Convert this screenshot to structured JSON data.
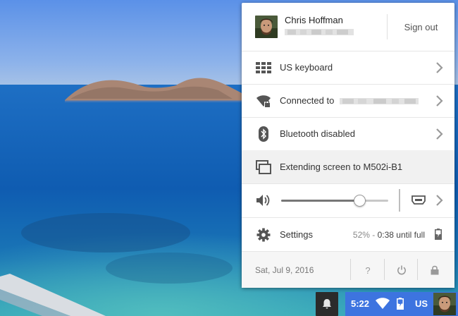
{
  "user": {
    "name": "Chris Hoffman",
    "signout_label": "Sign out"
  },
  "menu": {
    "keyboard_label": "US keyboard",
    "wifi_prefix": "Connected to",
    "bluetooth_label": "Bluetooth disabled",
    "display_label": "Extending screen to M502i-B1",
    "volume_level": 0.73,
    "settings_label": "Settings",
    "battery_percent": "52%",
    "battery_sep": " - ",
    "battery_remaining": "0:38 until full"
  },
  "footer": {
    "date": "Sat, Jul 9, 2016",
    "help_label": "?"
  },
  "shelf": {
    "time": "5:22",
    "ime_indicator": "US"
  },
  "icons": {
    "keyboard": "keyboard-icon",
    "wifi": "wifi-lock-icon",
    "bluetooth": "bluetooth-icon",
    "display": "display-extend-icon",
    "volume": "speaker-icon",
    "hdmi": "hdmi-output-icon",
    "settings": "gear-icon",
    "power": "power-icon",
    "lock": "lock-icon",
    "notifications": "bell-icon",
    "chevron": "chevron-right-icon"
  },
  "colors": {
    "status_area": "#3d74e0",
    "shelf_button": "#2b2b2b",
    "active_row": "#f1f1f1"
  }
}
